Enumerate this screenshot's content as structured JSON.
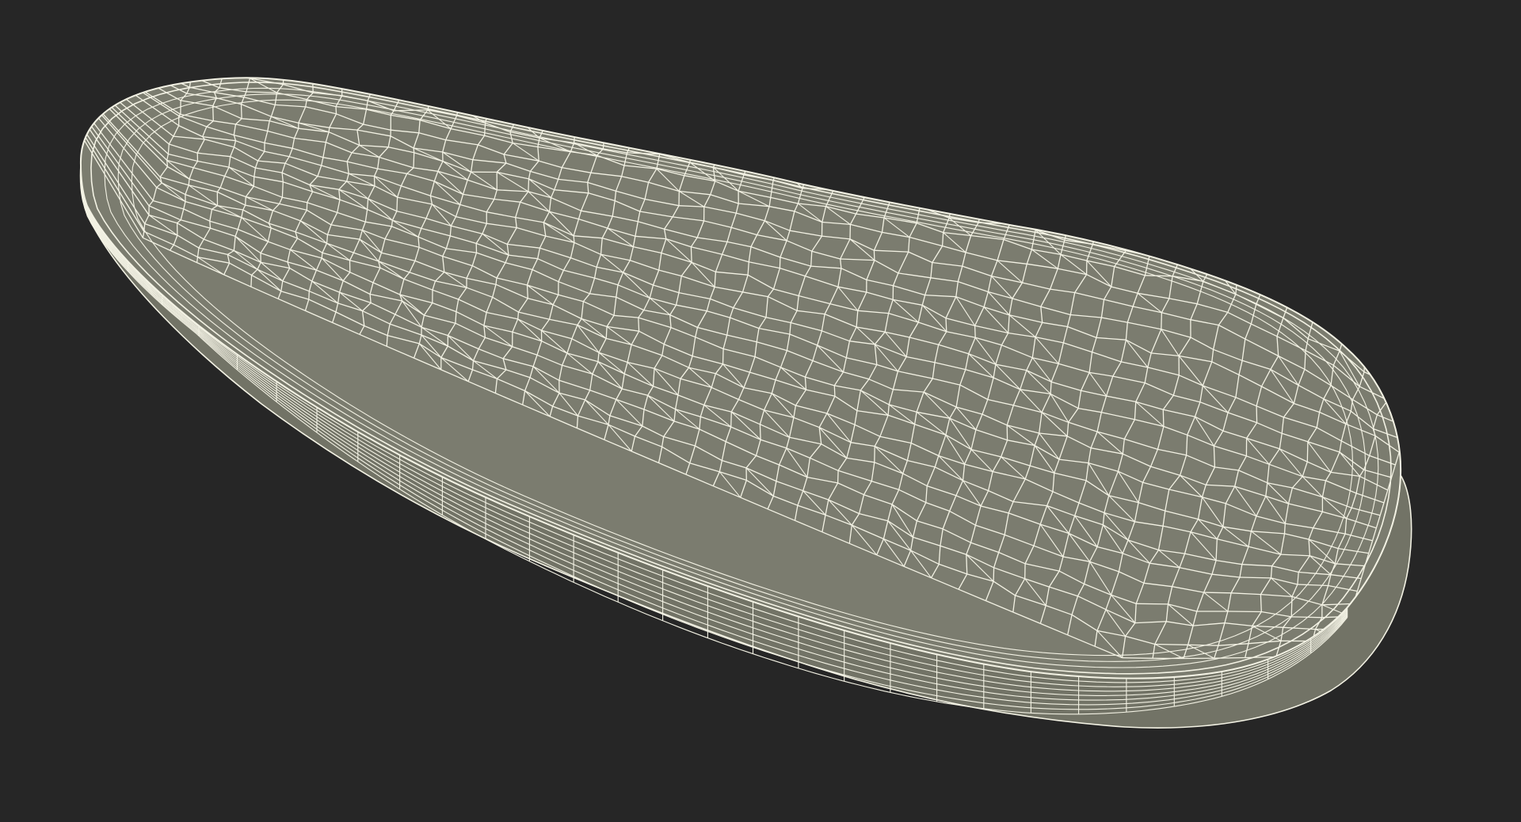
{
  "scene": {
    "subject": "insole-wireframe-render",
    "colors": {
      "background": "#262626",
      "surface": "#7b7c6f",
      "surface_shade": "#6c6d61",
      "side_wall": "#727366",
      "wire": "#f3f2e4",
      "wire_dim": "#d9d8c8"
    }
  }
}
